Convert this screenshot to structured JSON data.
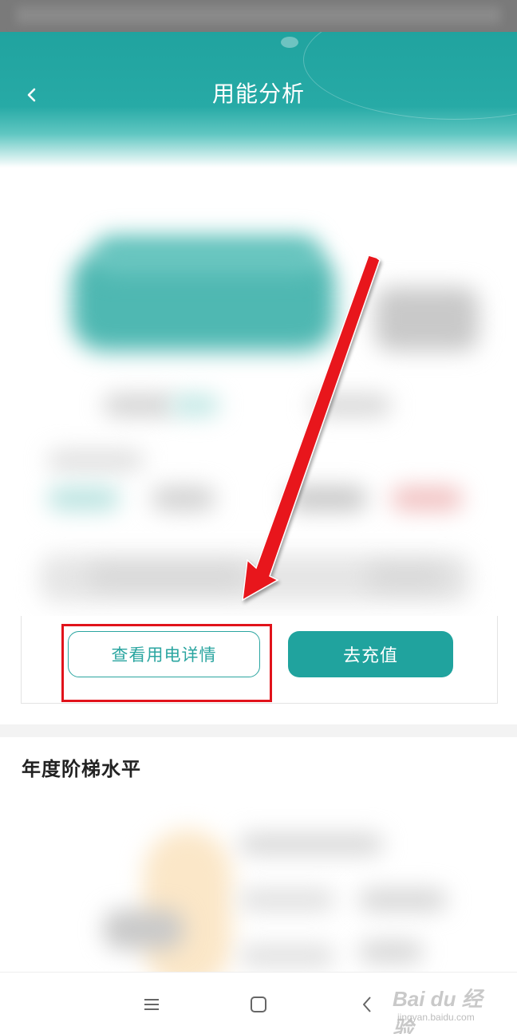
{
  "header": {
    "title": "用能分析",
    "back_icon": "chevron-left-icon",
    "background": "#27aaa6"
  },
  "actions": {
    "view_detail_label": "查看用电详情",
    "recharge_label": "去充值",
    "accent": "#20a39e",
    "highlight_color": "#e1131b"
  },
  "section": {
    "title": "年度阶梯水平"
  },
  "navbar": {
    "menu_icon": "menu-icon",
    "home_icon": "square-home-icon",
    "back_icon": "back-triangle-icon"
  },
  "watermark": {
    "main": "Bai du 经验",
    "sub": "jingyan.baidu.com"
  }
}
